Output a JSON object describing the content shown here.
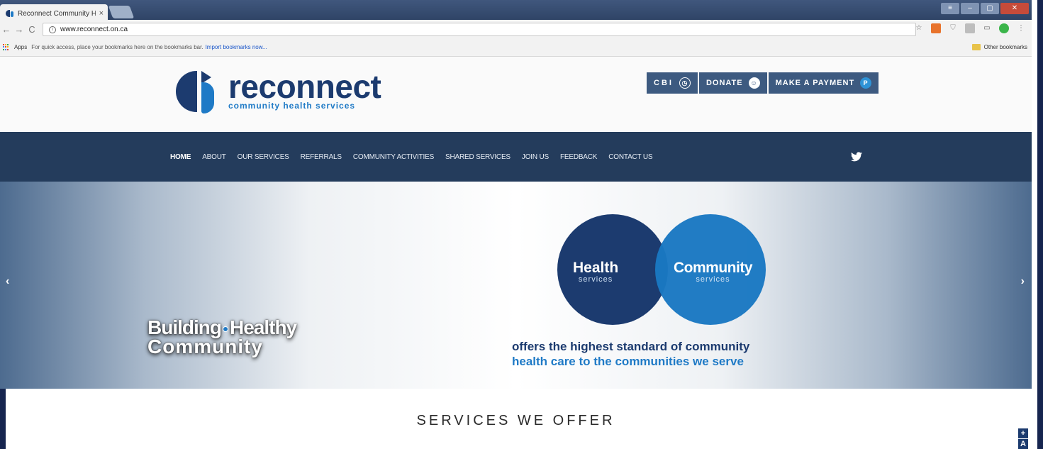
{
  "browser": {
    "tab_title": "Reconnect Community H",
    "tab_close": "×",
    "url": "www.reconnect.on.ca",
    "bookmarks_apps": "Apps",
    "bookmarks_hint": "For quick access, place your bookmarks here on the bookmarks bar.",
    "bookmarks_import": "Import bookmarks now...",
    "other_bookmarks": "Other bookmarks"
  },
  "header": {
    "logo_name": "reconnect",
    "logo_tagline": "community health services",
    "buttons": [
      {
        "label": "CBI",
        "icon": "clock-icon"
      },
      {
        "label": "DONATE",
        "icon": "person-icon"
      },
      {
        "label": "MAKE A PAYMENT",
        "icon": "paypal-icon"
      }
    ]
  },
  "nav": {
    "items": [
      "HOME",
      "ABOUT",
      "OUR SERVICES",
      "REFERRALS",
      "COMMUNITY ACTIVITIES",
      "SHARED SERVICES",
      "JOIN US",
      "FEEDBACK",
      "CONTACT US"
    ],
    "active": "HOME"
  },
  "hero": {
    "tagline_line1a": "Building",
    "tagline_line1b": "Healthy",
    "tagline_line2": "Community",
    "circle_left_big": "Health",
    "circle_left_small": "services",
    "circle_right_big": "Community",
    "circle_right_small": "services",
    "offer_line1": "offers the highest standard of community",
    "offer_line2": "health care to the communities we serve",
    "prev": "‹",
    "next": "›"
  },
  "services": {
    "title": "SERVICES WE OFFER"
  },
  "accessibility": {
    "plus": "+",
    "a": "A"
  },
  "colors": {
    "brand_dark": "#1c3b6f",
    "brand_blue": "#1f7ac6",
    "nav_bg": "#243c5c",
    "button_bg": "#3d5a80"
  }
}
